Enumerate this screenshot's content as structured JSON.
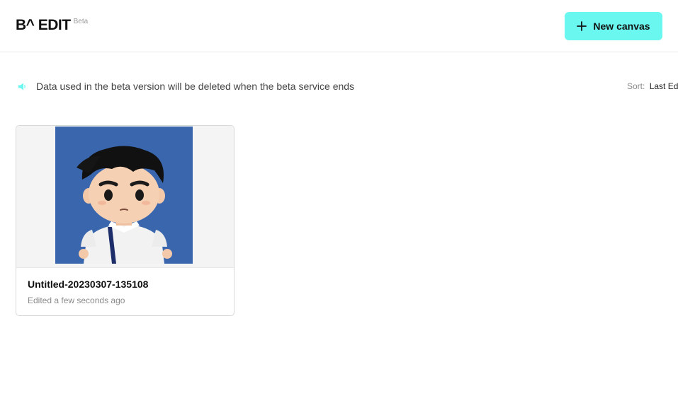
{
  "header": {
    "logo": "B^ EDIT",
    "badge": "Beta",
    "new_canvas_label": "New canvas",
    "accent_color": "#6af7ef"
  },
  "notice": {
    "icon": "speaker-icon",
    "text": "Data used in the beta version will be deleted when the beta service ends"
  },
  "sort": {
    "label": "Sort:",
    "value": "Last Ed"
  },
  "canvases": [
    {
      "title": "Untitled-20230307-135108",
      "edited": "Edited a few seconds ago",
      "thumbnail": "3d-avatar-thumbnail"
    }
  ]
}
